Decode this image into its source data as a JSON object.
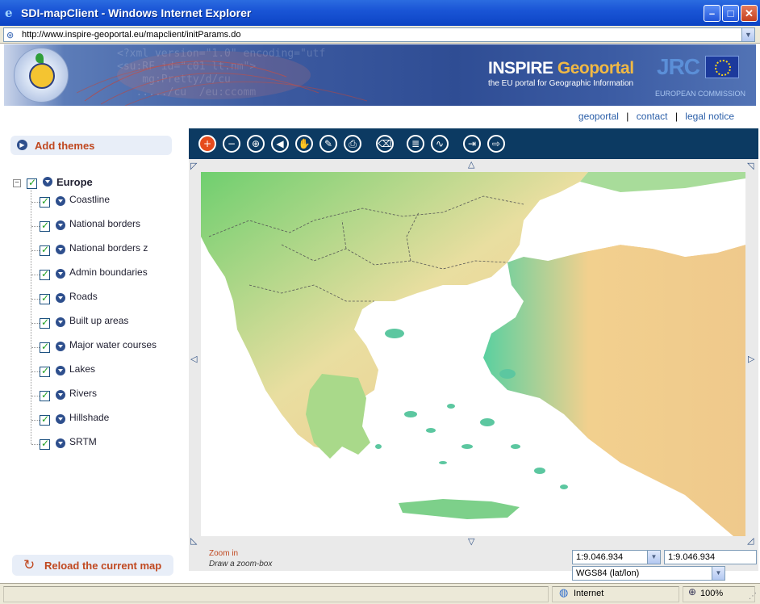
{
  "window": {
    "title": "SDI-mapClient - Windows Internet Explorer",
    "minimize": "–",
    "maximize": "□",
    "close": "✕"
  },
  "address": {
    "url": "http://www.inspire-geoportal.eu/mapclient/initParams.do"
  },
  "banner": {
    "brand_main": "INSPIRE ",
    "brand_accent": "Geoportal",
    "tagline": "the EU portal for Geographic Information",
    "jrc": "JRC",
    "commission": "EUROPEAN COMMISSION",
    "logo_ring": "INSPIRE · Infrastructure for Spatial Information in Europe",
    "xml_bg": "<?xml version=\"1.0\" encoding=\"utf\n<su:RF id=\"c01 lt.nm\">\n    mg:Pretty/d/cu\n   ...../cu  /eu:ccomm"
  },
  "links": {
    "geoportal": "geoportal",
    "contact": "contact",
    "legal": "legal notice",
    "sep": "|"
  },
  "sidebar": {
    "add_themes": "Add themes",
    "reload": "Reload the current map",
    "tree": {
      "root": "Europe",
      "layers": [
        "Coastline",
        "National borders",
        "National borders z",
        "Admin boundaries",
        "Roads",
        "Built up areas",
        "Major water courses",
        "Lakes",
        "Rivers",
        "Hillshade",
        "SRTM"
      ]
    }
  },
  "map": {
    "status_tool": "Zoom in",
    "status_hint": "Draw a zoom-box",
    "scale_selected": "1:9.046.934",
    "scale_value": "1:9.046.934",
    "crs": "WGS84 (lat/lon)"
  },
  "statusbar": {
    "zone": "Internet",
    "zoom": "100%"
  },
  "colors": {
    "toolbar": "#0c3a62",
    "accent": "#c04820",
    "link": "#2a5ea8"
  }
}
